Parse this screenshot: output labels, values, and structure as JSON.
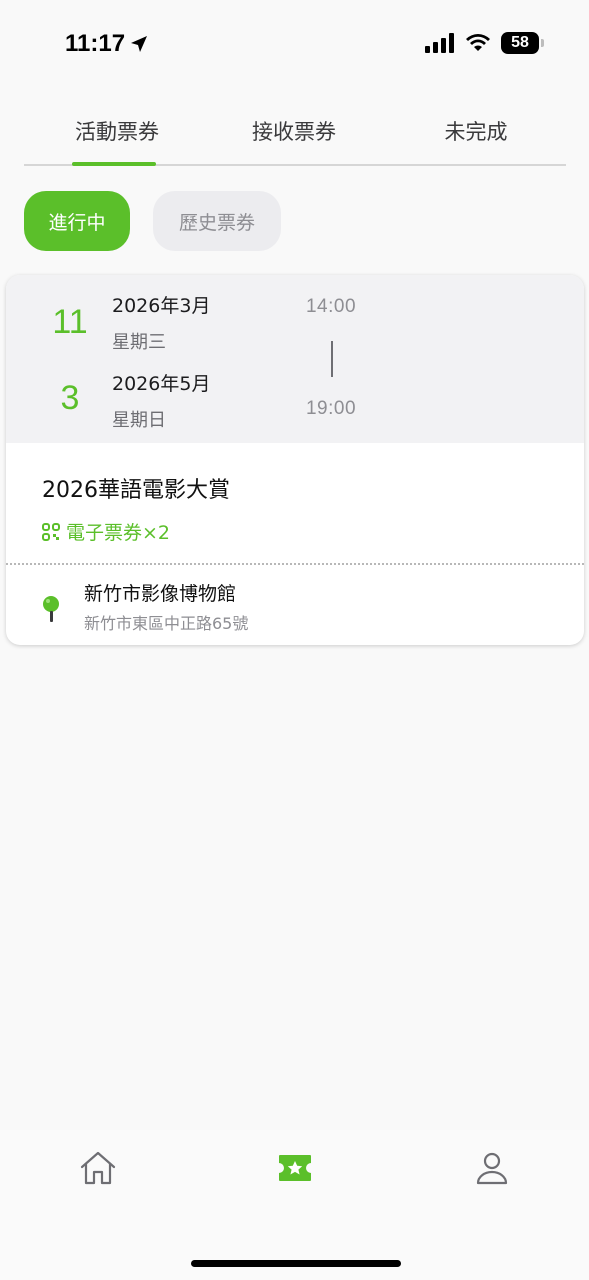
{
  "status": {
    "time": "11:17",
    "battery": "58"
  },
  "tabs": [
    {
      "label": "活動票券",
      "active": true
    },
    {
      "label": "接收票券",
      "active": false
    },
    {
      "label": "未完成",
      "active": false
    }
  ],
  "filters": {
    "active": "進行中",
    "history": "歷史票券"
  },
  "ticket": {
    "start": {
      "day": "11",
      "year_month": "2026年3月",
      "weekday": "星期三",
      "time": "14:00"
    },
    "end": {
      "day": "3",
      "year_month": "2026年5月",
      "weekday": "星期日",
      "time": "19:00"
    },
    "title": "2026華語電影大賞",
    "eticket_label": "電子票券×2",
    "venue_name": "新竹市影像博物館",
    "venue_address": "新竹市東區中正路65號"
  },
  "colors": {
    "accent": "#5bbf2a",
    "card_top": "#f2f2f4",
    "pill_inactive": "#ececef"
  },
  "nav": {
    "icons": [
      "home-icon",
      "ticket-star-icon",
      "user-icon"
    ],
    "active": "ticket-star-icon"
  }
}
